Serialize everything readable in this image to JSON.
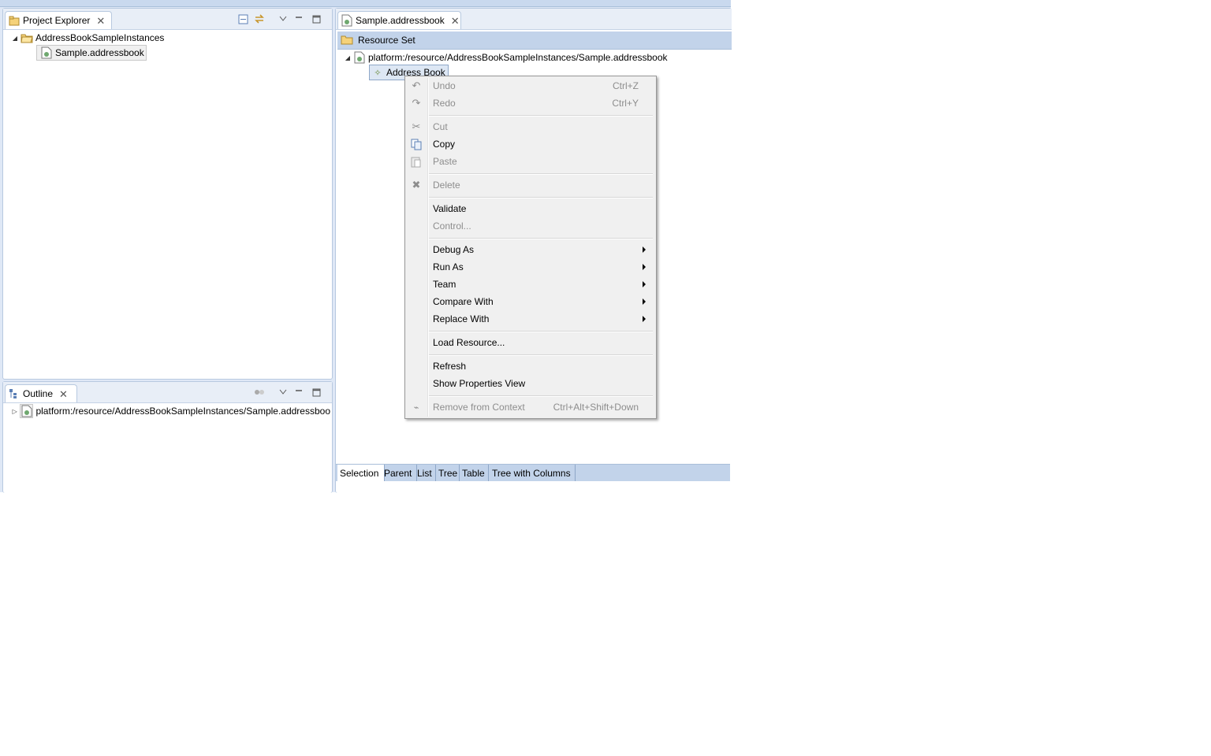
{
  "project_explorer": {
    "title": "Project Explorer",
    "tree": [
      {
        "label": "AddressBookSampleInstances",
        "expanded": true,
        "icon": "project-folder-icon"
      },
      {
        "label": "Sample.addressbook",
        "icon": "model-file-icon",
        "selected": true
      }
    ]
  },
  "outline": {
    "title": "Outline",
    "tree": [
      {
        "label": "platform:/resource/AddressBookSampleInstances/Sample.addressboo",
        "expanded": false,
        "icon": "model-file-icon"
      }
    ]
  },
  "editor": {
    "tab_title": "Sample.addressbook",
    "header": "Resource Set",
    "tree": [
      {
        "label": "platform:/resource/AddressBookSampleInstances/Sample.addressbook",
        "expanded": true,
        "icon": "model-file-icon"
      },
      {
        "label": "Address Book",
        "icon": "address-book-icon",
        "selected": true
      }
    ],
    "bottom_tabs": [
      "Selection",
      "Parent",
      "List",
      "Tree",
      "Table",
      "Tree with Columns"
    ],
    "active_bottom_tab": "Selection"
  },
  "context_menu": {
    "items": [
      {
        "label": "Undo",
        "shortcut": "Ctrl+Z",
        "enabled": false,
        "icon": "undo-icon"
      },
      {
        "label": "Redo",
        "shortcut": "Ctrl+Y",
        "enabled": false,
        "icon": "redo-icon"
      },
      {
        "label": "Cut",
        "shortcut": "",
        "enabled": false,
        "icon": "cut-icon"
      },
      {
        "label": "Copy",
        "shortcut": "",
        "enabled": true,
        "icon": "copy-icon"
      },
      {
        "label": "Paste",
        "shortcut": "",
        "enabled": false,
        "icon": "paste-icon"
      },
      {
        "label": "Delete",
        "shortcut": "",
        "enabled": false,
        "icon": "delete-icon"
      },
      {
        "label": "Validate",
        "shortcut": "",
        "enabled": true
      },
      {
        "label": "Control...",
        "shortcut": "",
        "enabled": false
      },
      {
        "label": "Debug As",
        "submenu": true,
        "enabled": true
      },
      {
        "label": "Run As",
        "submenu": true,
        "enabled": true
      },
      {
        "label": "Team",
        "submenu": true,
        "enabled": true
      },
      {
        "label": "Compare With",
        "submenu": true,
        "enabled": true
      },
      {
        "label": "Replace With",
        "submenu": true,
        "enabled": true
      },
      {
        "label": "Load Resource...",
        "shortcut": "",
        "enabled": true
      },
      {
        "label": "Refresh",
        "shortcut": "",
        "enabled": true
      },
      {
        "label": "Show Properties View",
        "shortcut": "",
        "enabled": true
      },
      {
        "label": "Remove from Context",
        "shortcut": "Ctrl+Alt+Shift+Down",
        "enabled": false,
        "icon": "remove-context-icon"
      }
    ]
  },
  "colors": {
    "workbench_bg": "#dfe8f6",
    "menu_bg": "#f0f0f0",
    "disabled_text": "#8d8d8d"
  }
}
